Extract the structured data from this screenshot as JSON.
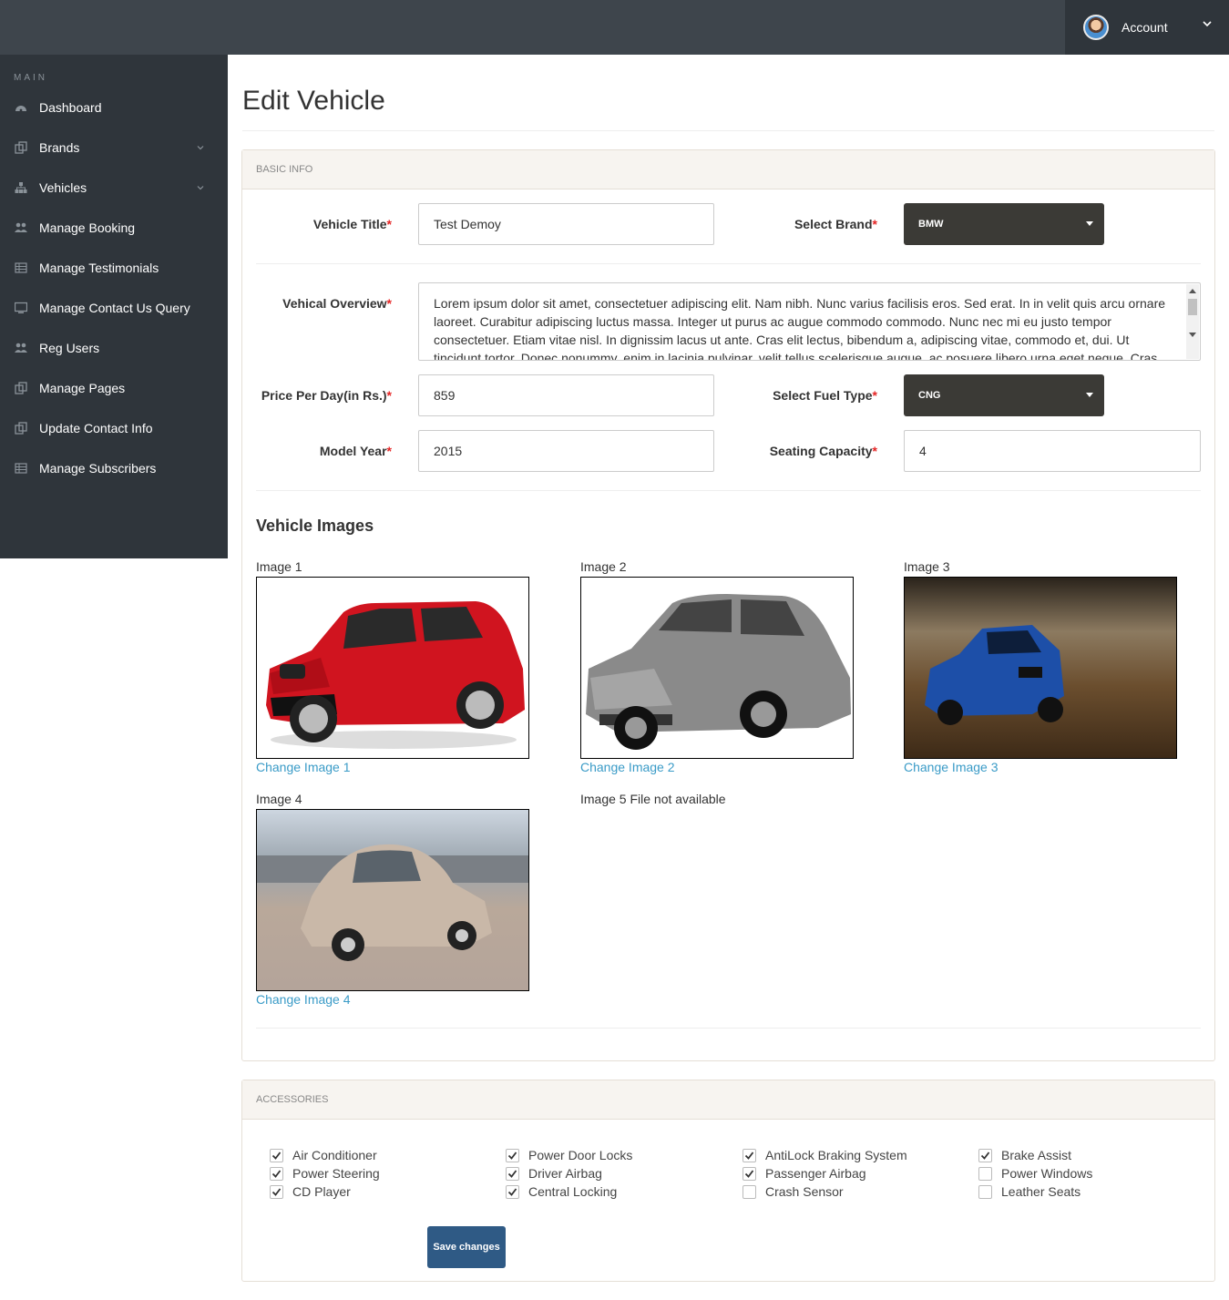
{
  "header": {
    "account_label": "Account"
  },
  "sidebar": {
    "heading": "MAIN",
    "items": [
      {
        "label": "Dashboard",
        "icon": "dashboard-icon",
        "has_caret": false
      },
      {
        "label": "Brands",
        "icon": "files-icon",
        "has_caret": true
      },
      {
        "label": "Vehicles",
        "icon": "sitemap-icon",
        "has_caret": true
      },
      {
        "label": "Manage Booking",
        "icon": "users-icon",
        "has_caret": false
      },
      {
        "label": "Manage Testimonials",
        "icon": "table-icon",
        "has_caret": false
      },
      {
        "label": "Manage Contact Us Query",
        "icon": "desktop-icon",
        "has_caret": false
      },
      {
        "label": "Reg Users",
        "icon": "users-icon",
        "has_caret": false
      },
      {
        "label": "Manage Pages",
        "icon": "files-icon",
        "has_caret": false
      },
      {
        "label": "Update Contact Info",
        "icon": "files-icon",
        "has_caret": false
      },
      {
        "label": "Manage Subscribers",
        "icon": "table-icon",
        "has_caret": false
      }
    ]
  },
  "page": {
    "title": "Edit Vehicle"
  },
  "basic_info": {
    "heading": "BASIC INFO",
    "vehicle_title_label": "Vehicle Title",
    "vehicle_title_value": "Test Demoy",
    "brand_label": "Select Brand",
    "brand_value": "BMW",
    "overview_label": "Vehical Overview",
    "overview_value": "Lorem ipsum dolor sit amet, consectetuer adipiscing elit. Nam nibh. Nunc varius facilisis eros. Sed erat. In in velit quis arcu ornare laoreet. Curabitur adipiscing luctus massa. Integer ut purus ac augue commodo commodo. Nunc nec mi eu justo tempor consectetuer. Etiam vitae nisl. In dignissim lacus ut ante. Cras elit lectus, bibendum a, adipiscing vitae, commodo et, dui. Ut tincidunt tortor. Donec nonummy, enim in lacinia pulvinar, velit tellus scelerisque augue, ac posuere libero urna eget neque. Cras",
    "price_label": "Price Per Day(in Rs.)",
    "price_value": "859",
    "fuel_label": "Select Fuel Type",
    "fuel_value": "CNG",
    "year_label": "Model Year",
    "year_value": "2015",
    "seating_label": "Seating Capacity",
    "seating_value": "4",
    "required_mark": "*"
  },
  "vehicle_images": {
    "heading": "Vehicle Images",
    "images": [
      {
        "caption": "Image 1",
        "link": "Change Image 1"
      },
      {
        "caption": "Image 2",
        "link": "Change Image 2"
      },
      {
        "caption": "Image 3",
        "link": "Change Image 3"
      },
      {
        "caption": "Image 4",
        "link": "Change Image 4"
      }
    ],
    "image5_text": "Image 5 File not available"
  },
  "accessories": {
    "heading": "ACCESSORIES",
    "items": [
      {
        "label": "Air Conditioner",
        "checked": true
      },
      {
        "label": "Power Steering",
        "checked": true
      },
      {
        "label": "CD Player",
        "checked": true
      },
      {
        "label": "Power Door Locks",
        "checked": true
      },
      {
        "label": "Driver Airbag",
        "checked": true
      },
      {
        "label": "Central Locking",
        "checked": true
      },
      {
        "label": "AntiLock Braking System",
        "checked": true
      },
      {
        "label": "Passenger Airbag",
        "checked": true
      },
      {
        "label": "Crash Sensor",
        "checked": false
      },
      {
        "label": "Brake Assist",
        "checked": true
      },
      {
        "label": "Power Windows",
        "checked": false
      },
      {
        "label": "Leather Seats",
        "checked": false
      }
    ],
    "save_label": "Save changes"
  },
  "colors": {
    "topbar": "#3e454c",
    "sidebar": "#2f353b",
    "select_bg": "#3b3a36",
    "link": "#3a9bc7",
    "button": "#2f5a85",
    "required": "#e52424"
  }
}
